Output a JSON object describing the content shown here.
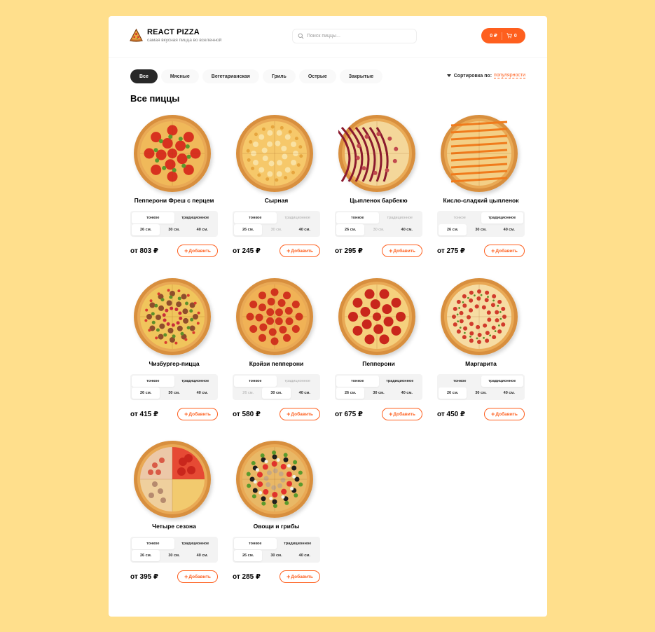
{
  "header": {
    "title": "REACT PIZZA",
    "subtitle": "самая вкусная пицца во вселенной",
    "search_placeholder": "Поиск пиццы...",
    "cart_total": "0 ₽",
    "cart_count": "0"
  },
  "categories": [
    "Все",
    "Мясные",
    "Вегетарианская",
    "Гриль",
    "Острые",
    "Закрытые"
  ],
  "sort": {
    "label": "Сортировка по:",
    "value": "популярности"
  },
  "page_title": "Все пиццы",
  "add_label": "Добавить",
  "colors": {
    "accent": "#fe5f1e",
    "background": "#ffdf8c",
    "dark": "#282828"
  },
  "pizzas": [
    {
      "name": "Пепперони Фреш с перцем",
      "price": "от 803 ₽",
      "types": [
        "тонкое",
        "традиционное"
      ],
      "sizes": [
        "26 см.",
        "30 см.",
        "40 см."
      ],
      "type_state": [
        "active",
        "normal"
      ],
      "size_state": [
        "active",
        "normal",
        "normal"
      ],
      "style": "pepperoni-pepper"
    },
    {
      "name": "Сырная",
      "price": "от 245 ₽",
      "types": [
        "тонкое",
        "традиционное"
      ],
      "sizes": [
        "26 см.",
        "30 см.",
        "40 см."
      ],
      "type_state": [
        "active",
        "disabled"
      ],
      "size_state": [
        "active",
        "disabled",
        "normal"
      ],
      "style": "cheese"
    },
    {
      "name": "Цыпленок барбекю",
      "price": "от 295 ₽",
      "types": [
        "тонкое",
        "традиционное"
      ],
      "sizes": [
        "26 см.",
        "30 см.",
        "40 см."
      ],
      "type_state": [
        "active",
        "disabled"
      ],
      "size_state": [
        "active",
        "disabled",
        "normal"
      ],
      "style": "bbq"
    },
    {
      "name": "Кисло-сладкий цыпленок",
      "price": "от 275 ₽",
      "types": [
        "тонкое",
        "традиционное"
      ],
      "sizes": [
        "26 см.",
        "30 см.",
        "40 см."
      ],
      "type_state": [
        "disabled",
        "active"
      ],
      "size_state": [
        "active",
        "normal",
        "normal"
      ],
      "style": "sweet-sour"
    },
    {
      "name": "Чизбургер-пицца",
      "price": "от 415 ₽",
      "types": [
        "тонкое",
        "традиционное"
      ],
      "sizes": [
        "26 см.",
        "30 см.",
        "40 см."
      ],
      "type_state": [
        "active",
        "normal"
      ],
      "size_state": [
        "active",
        "normal",
        "normal"
      ],
      "style": "cheeseburger"
    },
    {
      "name": "Крэйзи пепперони",
      "price": "от 580 ₽",
      "types": [
        "тонкое",
        "традиционное"
      ],
      "sizes": [
        "26 см.",
        "30 см.",
        "40 см."
      ],
      "type_state": [
        "active",
        "disabled"
      ],
      "size_state": [
        "disabled",
        "active",
        "normal"
      ],
      "style": "crazy-pepperoni"
    },
    {
      "name": "Пепперони",
      "price": "от 675 ₽",
      "types": [
        "тонкое",
        "традиционное"
      ],
      "sizes": [
        "26 см.",
        "30 см.",
        "40 см."
      ],
      "type_state": [
        "active",
        "normal"
      ],
      "size_state": [
        "active",
        "normal",
        "normal"
      ],
      "style": "pepperoni"
    },
    {
      "name": "Маргарита",
      "price": "от 450 ₽",
      "types": [
        "тонкое",
        "традиционное"
      ],
      "sizes": [
        "26 см.",
        "30 см.",
        "40 см."
      ],
      "type_state": [
        "normal",
        "active"
      ],
      "size_state": [
        "active",
        "normal",
        "normal"
      ],
      "style": "margherita"
    },
    {
      "name": "Четыре сезона",
      "price": "от 395 ₽",
      "types": [
        "тонкое",
        "традиционное"
      ],
      "sizes": [
        "26 см.",
        "30 см.",
        "40 см."
      ],
      "type_state": [
        "active",
        "normal"
      ],
      "size_state": [
        "active",
        "normal",
        "normal"
      ],
      "style": "four-seasons"
    },
    {
      "name": "Овощи и грибы",
      "price": "от 285 ₽",
      "types": [
        "тонкое",
        "традиционное"
      ],
      "sizes": [
        "26 см.",
        "30 см.",
        "40 см."
      ],
      "type_state": [
        "active",
        "normal"
      ],
      "size_state": [
        "active",
        "normal",
        "normal"
      ],
      "style": "veggie"
    }
  ]
}
